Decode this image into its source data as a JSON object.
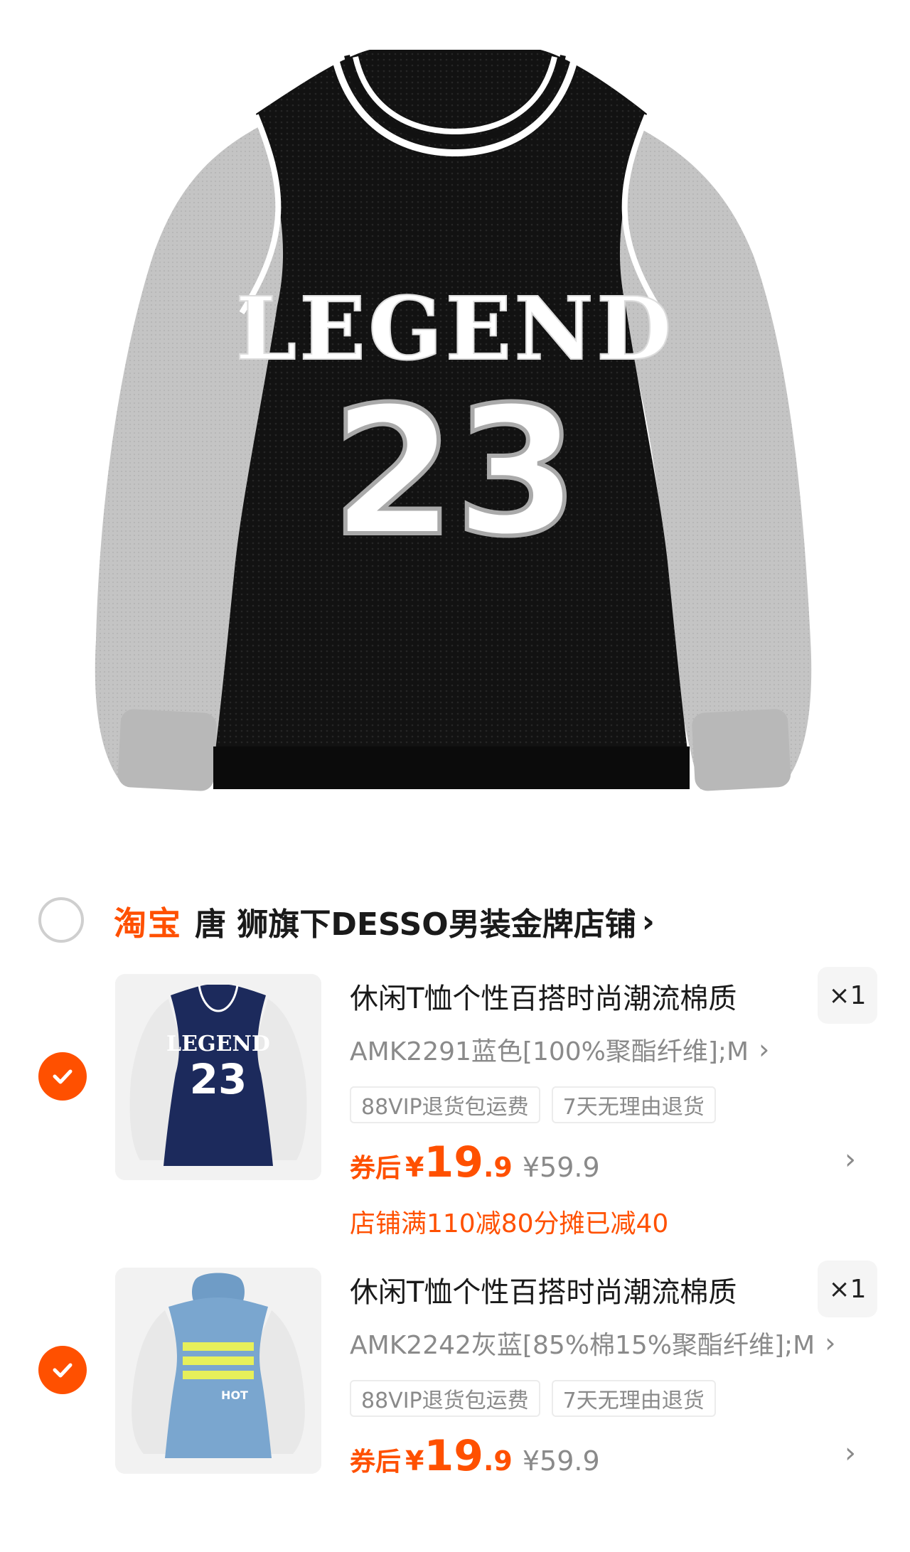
{
  "hero": {
    "jersey_text": "LEGEND",
    "jersey_number": "23",
    "icon": "jersey-sweatshirt-image"
  },
  "shop": {
    "logo": "淘宝",
    "name": "唐 狮旗下DESSO男装金牌店铺",
    "chevron": "›"
  },
  "items": [
    {
      "selected": true,
      "title": "休闲T恤个性百搭时尚潮流棉质",
      "quantity": "×1",
      "sku": "AMK2291蓝色[100%聚酯纤维];M",
      "sku_chevron": "›",
      "tags": [
        "88VIP退货包运费",
        "7天无理由退货"
      ],
      "coupon_label": "券后",
      "price_symbol": "¥",
      "price_integer": "19",
      "price_decimal": ".9",
      "original_price": "¥59.9",
      "row_chevron": "›",
      "promo": "店铺满110减80分摊已减40",
      "thumb_text": "LEGEND",
      "thumb_number": "23"
    },
    {
      "selected": true,
      "title": "休闲T恤个性百搭时尚潮流棉质",
      "quantity": "×1",
      "sku": "AMK2242灰蓝[85%棉15%聚酯纤维];M",
      "sku_chevron": "›",
      "tags": [
        "88VIP退货包运费",
        "7天无理由退货"
      ],
      "coupon_label": "券后",
      "price_symbol": "¥",
      "price_integer": "19",
      "price_decimal": ".9",
      "original_price": "¥59.9",
      "row_chevron": "›",
      "thumb_text": "HOT"
    }
  ],
  "colors": {
    "accent": "#ff5000",
    "muted": "#8a8a8a",
    "jersey_black": "#111111",
    "sleeve_grey": "#bdbdbd",
    "navy": "#1c2a5c",
    "hoodie_blue": "#7aa6cf"
  }
}
